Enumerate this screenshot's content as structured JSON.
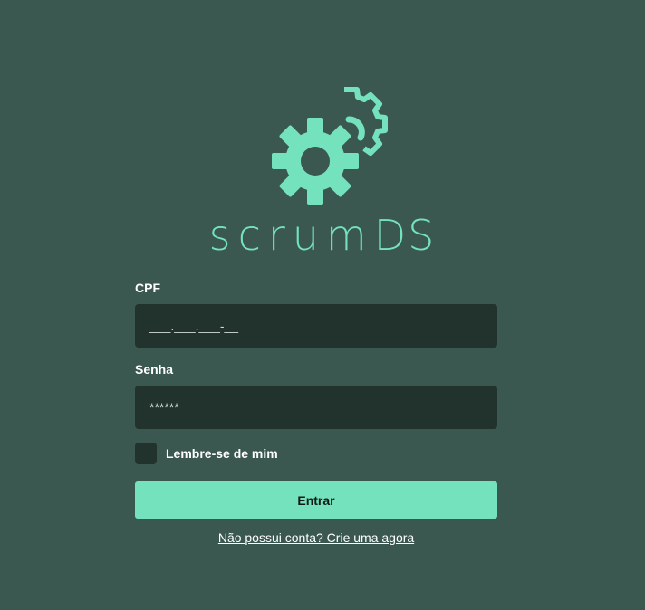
{
  "brand": {
    "name_lower": "scrum",
    "name_upper": "DS",
    "color": "#74e3bd",
    "logo_icon": "gears-icon"
  },
  "form": {
    "cpf": {
      "label": "CPF",
      "placeholder": "___.___.___-__"
    },
    "password": {
      "label": "Senha",
      "placeholder": "******"
    },
    "remember_label": "Lembre-se de mim",
    "submit_label": "Entrar",
    "signup_link": "Não possui conta? Crie uma agora"
  },
  "colors": {
    "background": "#3b5850",
    "input_background": "#22332e",
    "accent": "#74e3bd"
  }
}
